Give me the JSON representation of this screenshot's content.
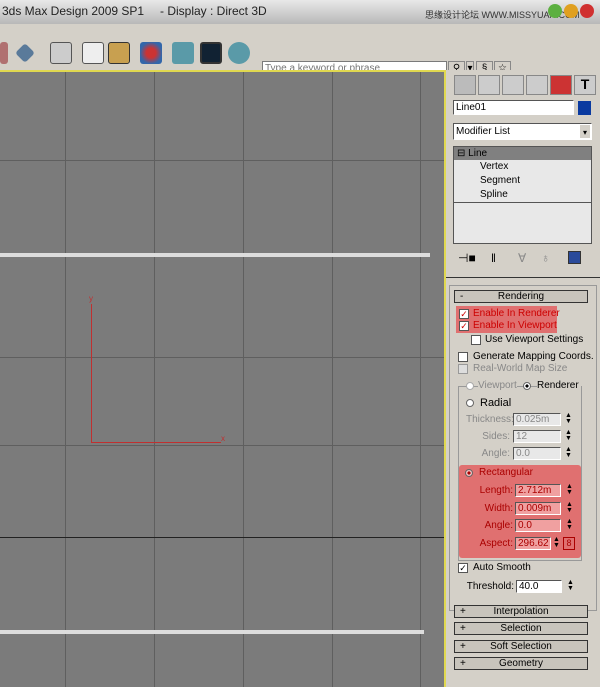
{
  "title": {
    "app": "3ds Max Design 2009 SP1",
    "display": "- Display : Direct 3D",
    "watermark": "思缘设计论坛 WWW.MISSYUAN.COM"
  },
  "search": {
    "placeholder": "Type a keyword or phrase"
  },
  "viewport": {
    "axis_x": "x",
    "axis_y": "y",
    "axis_color": "#c03030"
  },
  "panel": {
    "object_name": "Line01",
    "object_color": "#0a3aa0",
    "modifier_list": "Modifier List",
    "stack": {
      "root": "Line",
      "items": [
        "Vertex",
        "Segment",
        "Spline"
      ]
    },
    "rendering": {
      "title": "Rendering",
      "collapse": "-",
      "enable_renderer": "Enable In Renderer",
      "enable_viewport": "Enable In Viewport",
      "use_viewport_settings": "Use Viewport Settings",
      "gen_mapping": "Generate Mapping Coords.",
      "real_world": "Real-World Map Size",
      "viewport_radio": "Viewport",
      "renderer_radio": "Renderer",
      "radial": "Radial",
      "thickness_label": "Thickness:",
      "thickness": "0.025m",
      "sides_label": "Sides:",
      "sides": "12",
      "angle_label": "Angle:",
      "angle": "0.0",
      "rectangular": "Rectangular",
      "length_label": "Length:",
      "length": "2.712m",
      "width_label": "Width:",
      "width": "0.009m",
      "rangle_label": "Angle:",
      "rangle": "0.0",
      "aspect_label": "Aspect:",
      "aspect": "296.62",
      "auto_smooth": "Auto Smooth",
      "threshold_label": "Threshold:",
      "threshold": "40.0",
      "highlight": "#e07070"
    },
    "rollouts": [
      {
        "sign": "+",
        "label": "Interpolation"
      },
      {
        "sign": "+",
        "label": "Selection"
      },
      {
        "sign": "+",
        "label": "Soft Selection"
      },
      {
        "sign": "+",
        "label": "Geometry"
      }
    ]
  }
}
